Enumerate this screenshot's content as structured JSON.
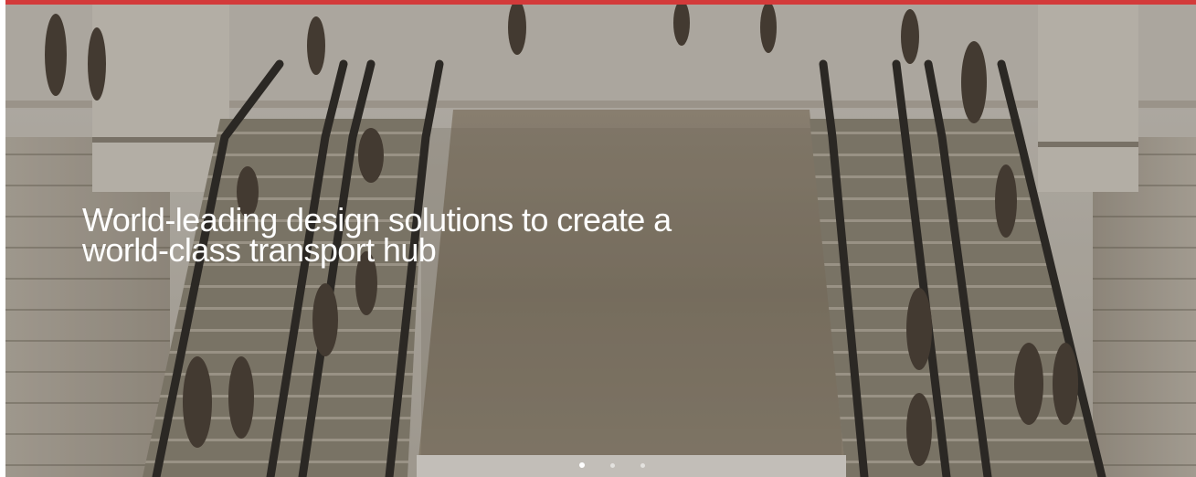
{
  "hero": {
    "caption_line1": "World-leading design solutions to create a",
    "caption_line2": "world-class transport hub",
    "image_subject": "escalators-in-transport-station"
  },
  "carousel": {
    "slide_count": 3,
    "active_index": 0
  },
  "colors": {
    "accent": "#d33a3a",
    "caption": "#ffffff",
    "dot_active": "#ffffff"
  }
}
